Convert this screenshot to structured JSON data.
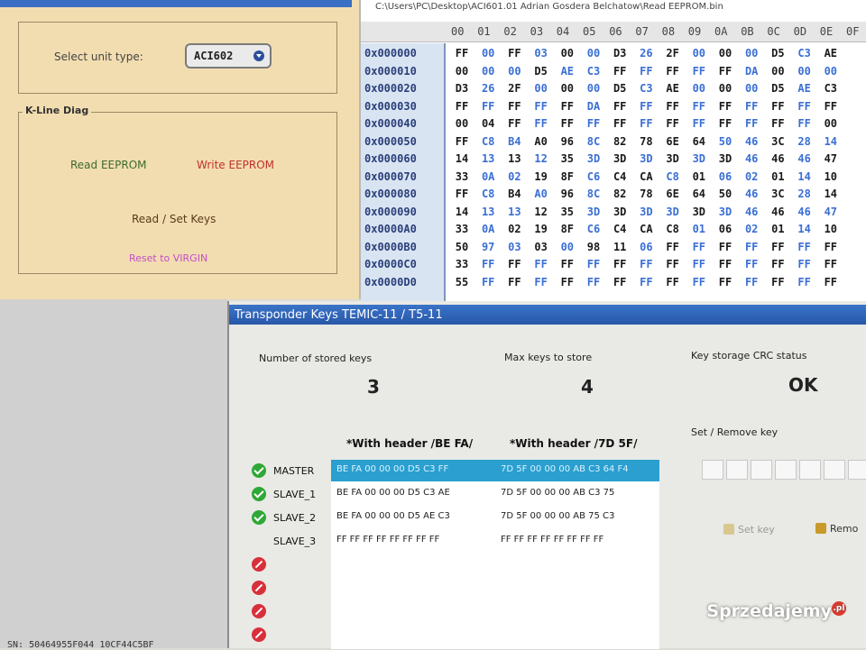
{
  "tool_panel": {
    "unit_label": "Select unit type:",
    "unit_value": "ACI602",
    "kline_title": "K-Line Diag",
    "read_eeprom": "Read EEPROM",
    "write_eeprom": "Write EEPROM",
    "read_set_keys": "Read / Set Keys",
    "reset_virgin": "Reset to VIRGIN",
    "colors": {
      "read": "#3d6b2e",
      "write": "#c0312b",
      "keys": "#5a3a1a",
      "virgin": "#c24fc7"
    }
  },
  "hex_editor": {
    "path": "C:\\Users\\PC\\Desktop\\ACI601.01 Adrian Gosdera Belchatow\\Read EEPROM.bin",
    "columns": [
      "00",
      "01",
      "02",
      "03",
      "04",
      "05",
      "06",
      "07",
      "08",
      "09",
      "0A",
      "0B",
      "0C",
      "0D",
      "0E",
      "0F"
    ],
    "rows": [
      {
        "addr": "0x000000",
        "bytes": [
          "FF",
          "00",
          "FF",
          "03",
          "00",
          "00",
          "D3",
          "26",
          "2F",
          "00",
          "00",
          "00",
          "D5",
          "C3",
          "AE"
        ]
      },
      {
        "addr": "0x000010",
        "bytes": [
          "00",
          "00",
          "00",
          "D5",
          "AE",
          "C3",
          "FF",
          "FF",
          "FF",
          "FF",
          "FF",
          "DA",
          "00",
          "00",
          "00"
        ]
      },
      {
        "addr": "0x000020",
        "bytes": [
          "D3",
          "26",
          "2F",
          "00",
          "00",
          "00",
          "D5",
          "C3",
          "AE",
          "00",
          "00",
          "00",
          "D5",
          "AE",
          "C3"
        ]
      },
      {
        "addr": "0x000030",
        "bytes": [
          "FF",
          "FF",
          "FF",
          "FF",
          "FF",
          "DA",
          "FF",
          "FF",
          "FF",
          "FF",
          "FF",
          "FF",
          "FF",
          "FF",
          "FF"
        ]
      },
      {
        "addr": "0x000040",
        "bytes": [
          "00",
          "04",
          "FF",
          "FF",
          "FF",
          "FF",
          "FF",
          "FF",
          "FF",
          "FF",
          "FF",
          "FF",
          "FF",
          "FF",
          "00"
        ]
      },
      {
        "addr": "0x000050",
        "bytes": [
          "FF",
          "C8",
          "B4",
          "A0",
          "96",
          "8C",
          "82",
          "78",
          "6E",
          "64",
          "50",
          "46",
          "3C",
          "28",
          "14"
        ]
      },
      {
        "addr": "0x000060",
        "bytes": [
          "14",
          "13",
          "13",
          "12",
          "35",
          "3D",
          "3D",
          "3D",
          "3D",
          "3D",
          "3D",
          "46",
          "46",
          "46",
          "47"
        ]
      },
      {
        "addr": "0x000070",
        "bytes": [
          "33",
          "0A",
          "02",
          "19",
          "8F",
          "C6",
          "C4",
          "CA",
          "C8",
          "01",
          "06",
          "02",
          "01",
          "14",
          "10"
        ]
      },
      {
        "addr": "0x000080",
        "bytes": [
          "FF",
          "C8",
          "B4",
          "A0",
          "96",
          "8C",
          "82",
          "78",
          "6E",
          "64",
          "50",
          "46",
          "3C",
          "28",
          "14"
        ]
      },
      {
        "addr": "0x000090",
        "bytes": [
          "14",
          "13",
          "13",
          "12",
          "35",
          "3D",
          "3D",
          "3D",
          "3D",
          "3D",
          "3D",
          "46",
          "46",
          "46",
          "47"
        ]
      },
      {
        "addr": "0x0000A0",
        "bytes": [
          "33",
          "0A",
          "02",
          "19",
          "8F",
          "C6",
          "C4",
          "CA",
          "C8",
          "01",
          "06",
          "02",
          "01",
          "14",
          "10"
        ]
      },
      {
        "addr": "0x0000B0",
        "bytes": [
          "50",
          "97",
          "03",
          "03",
          "00",
          "98",
          "11",
          "06",
          "FF",
          "FF",
          "FF",
          "FF",
          "FF",
          "FF",
          "FF"
        ]
      },
      {
        "addr": "0x0000C0",
        "bytes": [
          "33",
          "FF",
          "FF",
          "FF",
          "FF",
          "FF",
          "FF",
          "FF",
          "FF",
          "FF",
          "FF",
          "FF",
          "FF",
          "FF",
          "FF"
        ]
      },
      {
        "addr": "0x0000D0",
        "bytes": [
          "55",
          "FF",
          "FF",
          "FF",
          "FF",
          "FF",
          "FF",
          "FF",
          "FF",
          "FF",
          "FF",
          "FF",
          "FF",
          "FF",
          "FF"
        ]
      }
    ]
  },
  "dialog": {
    "title": "Transponder Keys TEMIC-11 / T5-11",
    "stored_label": "Number of stored keys",
    "stored_value": "3",
    "max_label": "Max keys to store",
    "max_value": "4",
    "crc_label": "Key storage CRC status",
    "crc_value": "OK",
    "col_a": "*With header /BE FA/",
    "col_b": "*With header /7D 5F/",
    "set_remove_label": "Set / Remove key",
    "set_key_btn": "Set key",
    "remove_btn": "Remo",
    "keys": [
      {
        "name": "MASTER",
        "status": "ok",
        "a": "BE FA 00 00 00 D5 C3 FF",
        "b": "7D 5F 00 00 00 AB C3 64 F4"
      },
      {
        "name": "SLAVE_1",
        "status": "ok",
        "a": "BE FA 00 00 00 D5 C3 AE",
        "b": "7D 5F 00 00 00 AB C3 75"
      },
      {
        "name": "SLAVE_2",
        "status": "ok",
        "a": "BE FA 00 00 00 D5 AE C3",
        "b": "7D 5F 00 00 00 AB 75 C3"
      },
      {
        "name": "SLAVE_3",
        "status": "pending",
        "a": "FF FF FF FF FF FF FF FF",
        "b": "FF FF FF FF FF FF FF FF"
      },
      {
        "name": "",
        "status": "no",
        "a": "",
        "b": ""
      },
      {
        "name": "",
        "status": "no",
        "a": "",
        "b": ""
      },
      {
        "name": "",
        "status": "no",
        "a": "",
        "b": ""
      },
      {
        "name": "",
        "status": "no",
        "a": "",
        "b": ""
      }
    ]
  },
  "watermark": {
    "text": "Sprzedajemy",
    "suffix": ".pl"
  },
  "footer": "SN: 50464955F044 10CF44C5BF"
}
